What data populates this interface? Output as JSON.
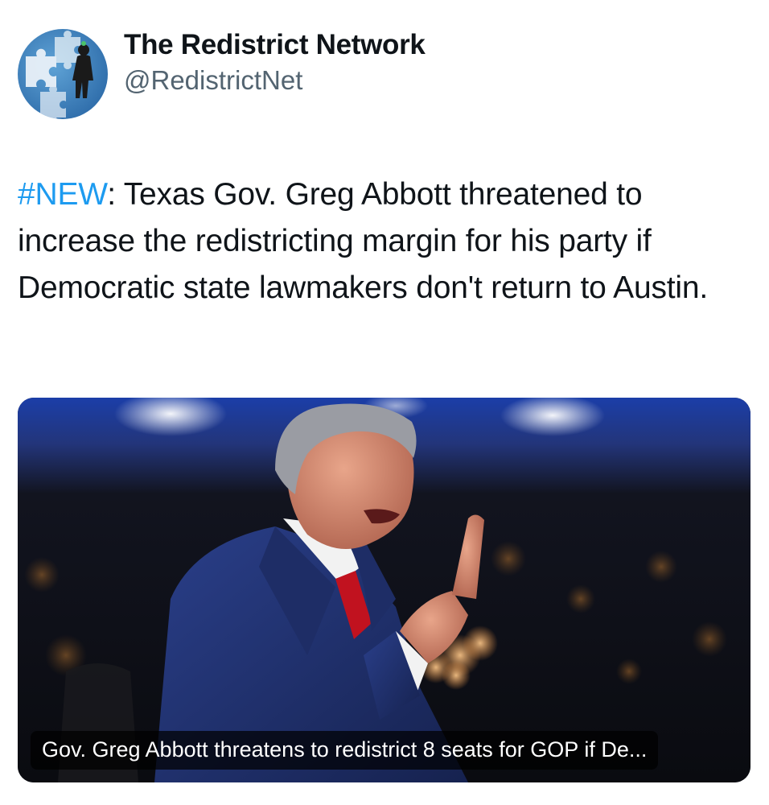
{
  "tweet": {
    "author": {
      "display_name": "The Redistrict Network",
      "handle": "@RedistrictNet",
      "avatar": "puzzle-pieces-avatar"
    },
    "text": {
      "hashtag": "#NEW",
      "body": ": Texas Gov. Greg Abbott threatened to increase the redistricting margin for his party if Democratic state lawmakers don't return to Austin."
    },
    "media": {
      "image": "greg-abbott-speaking-photo",
      "caption": "Gov. Greg Abbott threatens to redistrict 8 seats for GOP if De..."
    }
  },
  "colors": {
    "hashtag": "#1d9bf0",
    "handle": "#536471",
    "text": "#0f1419"
  }
}
